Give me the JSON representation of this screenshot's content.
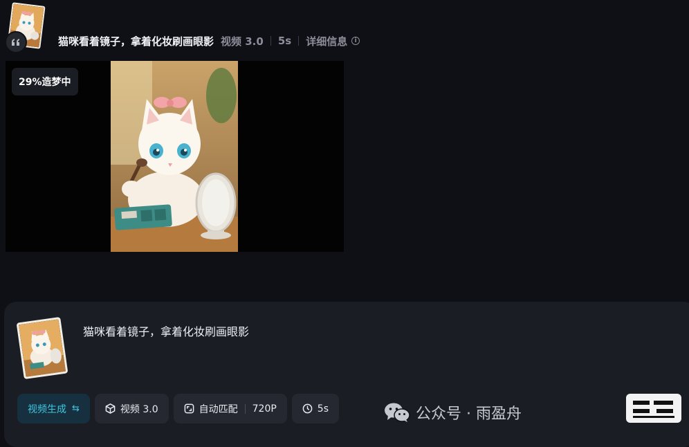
{
  "record": {
    "prompt": "猫咪看着镜子，拿着化妆刷画眼影",
    "model": "视频 3.0",
    "duration": "5s",
    "details_label": "详细信息",
    "progress": "29%造梦中",
    "avatar_icon": "quote-icon"
  },
  "composer": {
    "prompt": "猫咪看着镜子，拿着化妆刷画眼影",
    "mode": "视频生成",
    "model": "视频 3.0",
    "ratio": "自动匹配",
    "resolution": "720P",
    "duration": "5s"
  },
  "watermark": {
    "text": "公众号 · 雨盈舟",
    "icon": "wechat-icon"
  },
  "colors": {
    "background": "#0f1016",
    "panel": "#1b1d25",
    "chip": "#262831",
    "accent": "#3fc7e0"
  }
}
